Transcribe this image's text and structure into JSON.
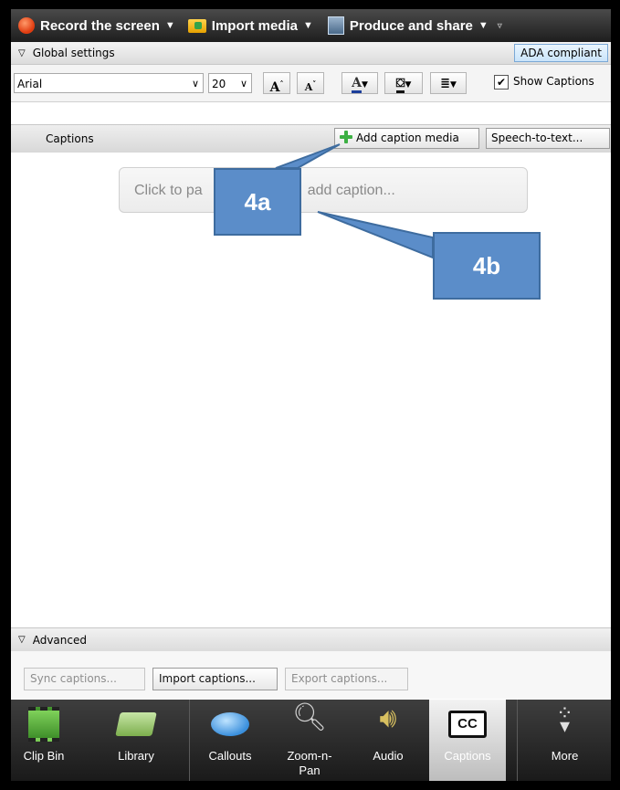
{
  "toolbar": {
    "record": "Record the screen",
    "import": "Import media",
    "produce": "Produce and share"
  },
  "global_settings": {
    "title": "Global settings",
    "ada": "ADA compliant"
  },
  "format": {
    "font": "Arial",
    "size": "20",
    "show_captions_checked": true,
    "show_captions": "Show Captions"
  },
  "captions": {
    "title": "Captions",
    "add_media": "Add caption media",
    "speech": "Speech-to-text...",
    "placeholder_left": "Click to pa",
    "placeholder_right": "add caption..."
  },
  "callouts": {
    "a": "4a",
    "b": "4b"
  },
  "advanced": {
    "title": "Advanced",
    "sync": "Sync captions...",
    "import": "Import captions...",
    "export": "Export captions..."
  },
  "tabs": {
    "clip_bin": "Clip Bin",
    "library": "Library",
    "callouts": "Callouts",
    "zoom_pan": "Zoom-n-\nPan",
    "audio": "Audio",
    "captions": "Captions",
    "more": "More"
  },
  "colors": {
    "callout_fill": "#5b8dc9",
    "accent_green": "#3cb043",
    "record_red": "#e03c10"
  }
}
